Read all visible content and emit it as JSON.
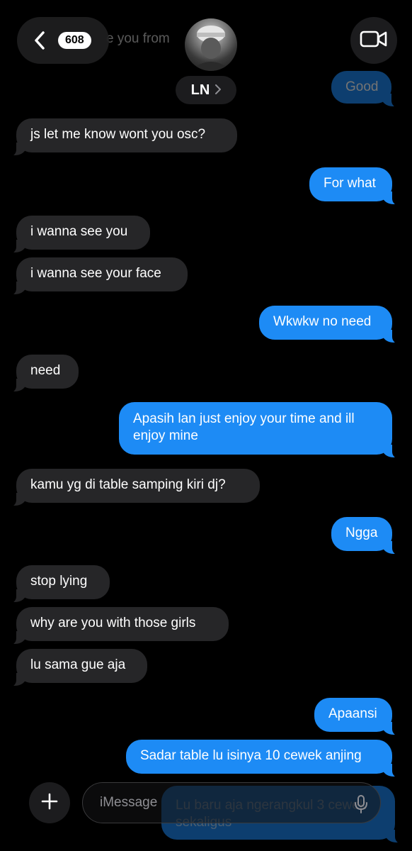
{
  "header": {
    "unread_count": "608",
    "contact_name": "LN",
    "ghost_preview": "e you from"
  },
  "messages": [
    {
      "dir": "out",
      "text": "Good"
    },
    {
      "dir": "in",
      "text": "js let me know wont you osc?"
    },
    {
      "dir": "out",
      "text": "For what"
    },
    {
      "dir": "in",
      "text": "i wanna see you"
    },
    {
      "dir": "in",
      "text": "i wanna see your face"
    },
    {
      "dir": "out",
      "text": "Wkwkw no need"
    },
    {
      "dir": "in",
      "text": "need"
    },
    {
      "dir": "out",
      "text": "Apasih lan just enjoy your time and ill enjoy mine"
    },
    {
      "dir": "in",
      "text": "kamu yg di table samping kiri dj?"
    },
    {
      "dir": "out",
      "text": "Ngga"
    },
    {
      "dir": "in",
      "text": "stop lying"
    },
    {
      "dir": "in",
      "text": "why are you with those girls"
    },
    {
      "dir": "in",
      "text": "lu sama gue aja"
    },
    {
      "dir": "out",
      "text": "Apaansi"
    },
    {
      "dir": "out",
      "text": "Sadar table lu isinya 10 cewek anjing"
    },
    {
      "dir": "out",
      "text": "Lu baru aja ngerangkul 3 cewek sekaligus"
    }
  ],
  "composer": {
    "placeholder": "iMessage"
  },
  "colors": {
    "background": "#000000",
    "incoming_bubble": "#262628",
    "outgoing_bubble": "#1d8bf5"
  },
  "icons": [
    "chevron-left-icon",
    "video-camera-icon",
    "chevron-right-icon",
    "plus-icon",
    "microphone-icon"
  ]
}
